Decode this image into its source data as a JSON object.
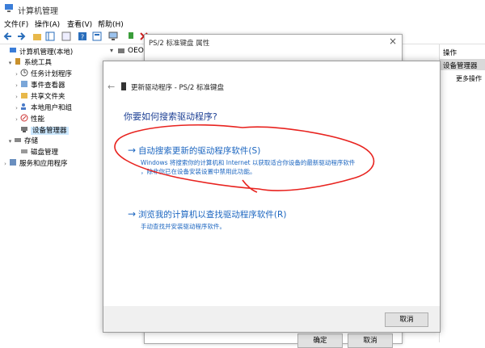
{
  "window": {
    "title": "计算机管理"
  },
  "menubar": {
    "items": [
      "文件(F)",
      "操作(A)",
      "查看(V)",
      "帮助(H)"
    ]
  },
  "tree": {
    "items": [
      {
        "label": "计算机管理(本地)",
        "icon": "computer-management-icon",
        "arrow": ""
      },
      {
        "label": "系统工具",
        "icon": "tools-icon",
        "arrow": "▾"
      },
      {
        "label": "任务计划程序",
        "icon": "clock-icon",
        "arrow": "›"
      },
      {
        "label": "事件查看器",
        "icon": "event-icon",
        "arrow": "›"
      },
      {
        "label": "共享文件夹",
        "icon": "folder-icon",
        "arrow": "›"
      },
      {
        "label": "本地用户和组",
        "icon": "users-icon",
        "arrow": "›"
      },
      {
        "label": "性能",
        "icon": "performance-icon",
        "arrow": "›"
      },
      {
        "label": "设备管理器",
        "icon": "device-manager-icon",
        "arrow": ""
      },
      {
        "label": "存储",
        "icon": "storage-icon",
        "arrow": "▾"
      },
      {
        "label": "磁盘管理",
        "icon": "disk-icon",
        "arrow": ""
      },
      {
        "label": "服务和应用程序",
        "icon": "services-icon",
        "arrow": "›"
      }
    ]
  },
  "devlist": {
    "root": "OEO"
  },
  "actions": {
    "header": "操作",
    "selected": "设备管理器",
    "more": "更多操作"
  },
  "props_dialog": {
    "title": "PS/2 标准键盘 属性",
    "ok_label": "确定",
    "cancel_label": "取消"
  },
  "wizard": {
    "header_title": "更新驱动程序 - PS/2 标准键盘",
    "question": "你要如何搜索驱动程序?",
    "option1_title": "自动搜索更新的驱动程序软件(S)",
    "option1_desc_line1": "Windows 将搜索你的计算机和 Internet 以获取适合你设备的最新驱动程序软件",
    "option1_desc_line2": "，除非你已在设备安装设置中禁用此功能。",
    "option2_title": "浏览我的计算机以查找驱动程序软件(R)",
    "option2_desc": "手动查找并安装驱动程序软件。",
    "cancel_label": "取消"
  },
  "colors": {
    "link_blue": "#1c66c0",
    "annotation_red": "#e8231f",
    "selection": "#cce8ff"
  }
}
